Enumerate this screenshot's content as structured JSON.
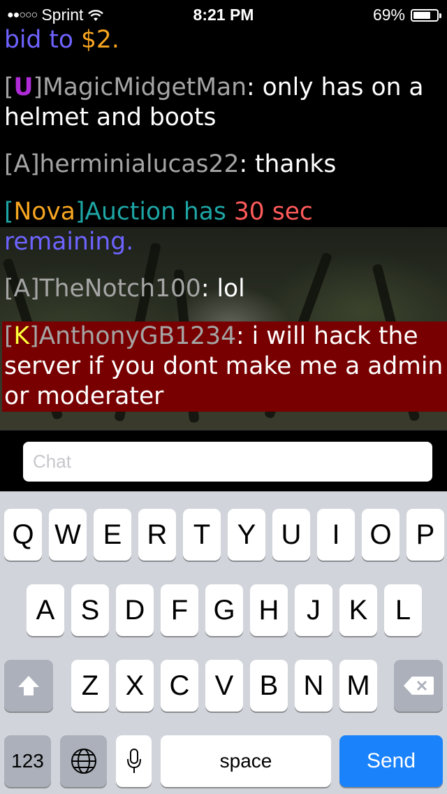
{
  "status": {
    "carrier": "Sprint",
    "signal": "●●○○○",
    "time": "8:21 PM",
    "battery": "69%",
    "battery_level": 0.69
  },
  "messages": {
    "m1": {
      "text1": "bid to ",
      "text2": "$2."
    },
    "m2": {
      "br_open": "[",
      "rank": "U",
      "br_close": "]",
      "user": "MagicMidgetMan",
      "sep": ": ",
      "text": "only has on a helmet and boots"
    },
    "m3": {
      "br_open": "[",
      "rank": "A",
      "br_close": "]",
      "user": "herminialucas22",
      "sep": ": ",
      "text": "thanks"
    },
    "m4": {
      "br_open": "[",
      "tag": "Nova",
      "br_close": "]",
      "text1": "Auction has ",
      "text2": "30 sec",
      "text3": " remaining."
    },
    "m5": {
      "br_open": "[",
      "rank": "A",
      "br_close": "]",
      "user": "TheNotch100",
      "sep": ": ",
      "text": "lol"
    },
    "m6": {
      "br_open": "[",
      "rank": "K",
      "br_close": "]",
      "user": "AnthonyGB1234",
      "sep": ": ",
      "text": "i will hack the server if you dont make me a admin or moderater"
    }
  },
  "input": {
    "placeholder": "Chat"
  },
  "keyboard": {
    "row1": [
      "Q",
      "W",
      "E",
      "R",
      "T",
      "Y",
      "U",
      "I",
      "O",
      "P"
    ],
    "row2": [
      "A",
      "S",
      "D",
      "F",
      "G",
      "H",
      "J",
      "K",
      "L"
    ],
    "row3": [
      "Z",
      "X",
      "C",
      "V",
      "B",
      "N",
      "M"
    ],
    "numbers_label": "123",
    "space_label": "space",
    "send_label": "Send",
    "shift_icon": "shift-arrow-icon",
    "delete_icon": "delete-backspace-icon",
    "globe_icon": "globe-icon",
    "mic_icon": "microphone-icon"
  },
  "colors": {
    "highlight": "#780000",
    "send": "#1a82fb",
    "server_purple": "#6e63ff",
    "amount_gold": "#f7a521",
    "teal": "#1ea5a5",
    "coral": "#ff5a5a",
    "rank_u": "#b02bd8",
    "rank_k": "#ffff3c"
  }
}
